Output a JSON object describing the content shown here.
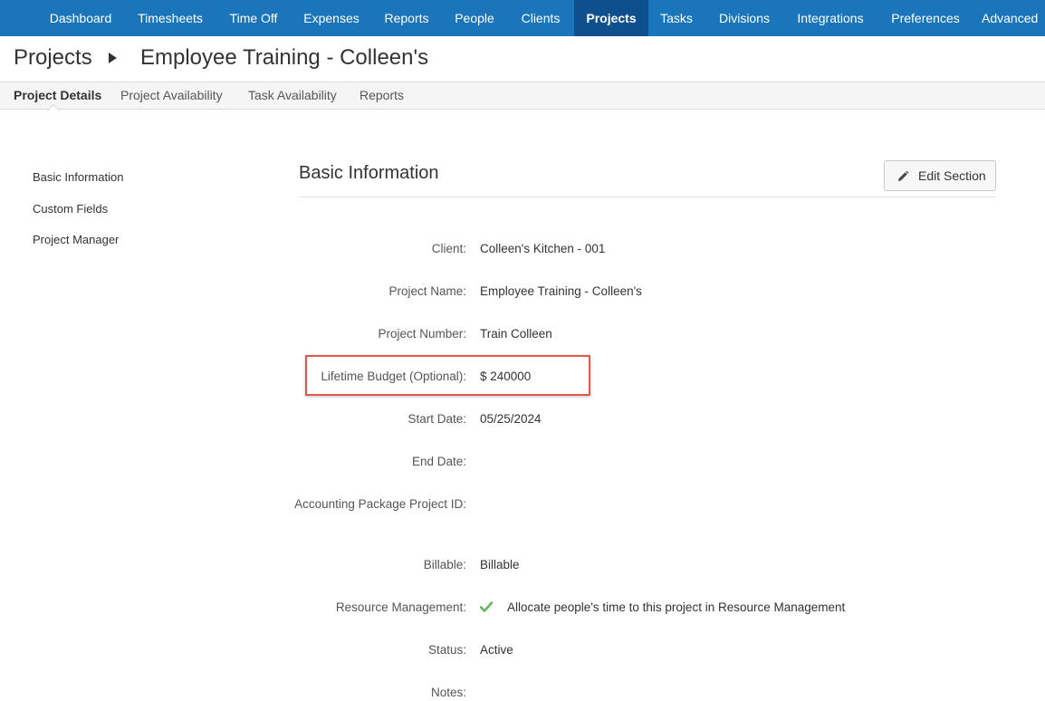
{
  "nav": {
    "items": [
      {
        "label": "Dashboard"
      },
      {
        "label": "Timesheets"
      },
      {
        "label": "Time Off"
      },
      {
        "label": "Expenses"
      },
      {
        "label": "Reports"
      },
      {
        "label": "People"
      },
      {
        "label": "Clients"
      },
      {
        "label": "Projects"
      },
      {
        "label": "Tasks"
      },
      {
        "label": "Divisions"
      },
      {
        "label": "Integrations"
      },
      {
        "label": "Preferences"
      },
      {
        "label": "Advanced"
      }
    ],
    "active": "Projects"
  },
  "breadcrumb": {
    "root": "Projects",
    "title": "Employee Training - Colleen's"
  },
  "subtabs": [
    {
      "label": "Project Details"
    },
    {
      "label": "Project Availability"
    },
    {
      "label": "Task Availability"
    },
    {
      "label": "Reports"
    }
  ],
  "sidebar": {
    "items": [
      {
        "label": "Basic Information"
      },
      {
        "label": "Custom Fields"
      },
      {
        "label": "Project Manager"
      }
    ]
  },
  "section": {
    "title": "Basic Information",
    "edit_label": "Edit Section"
  },
  "fields": {
    "client": {
      "label": "Client:",
      "value": "Colleen's Kitchen - 001"
    },
    "project_name": {
      "label": "Project Name:",
      "value": "Employee Training - Colleen's"
    },
    "project_number": {
      "label": "Project Number:",
      "value": "Train Colleen"
    },
    "lifetime_budget": {
      "label": "Lifetime Budget (Optional):",
      "value": "$ 240000"
    },
    "start_date": {
      "label": "Start Date:",
      "value": "05/25/2024"
    },
    "end_date": {
      "label": "End Date:",
      "value": ""
    },
    "accounting_id": {
      "label": "Accounting Package Project ID:",
      "value": ""
    },
    "billable": {
      "label": "Billable:",
      "value": "Billable"
    },
    "resource_management": {
      "label": "Resource Management:",
      "value": "Allocate people's time to this project in Resource Management"
    },
    "status": {
      "label": "Status:",
      "value": "Active"
    },
    "notes": {
      "label": "Notes:",
      "value": ""
    }
  },
  "colors": {
    "nav_bg": "#1b75bb",
    "nav_active": "#0e4f8e",
    "highlight": "#e4584b",
    "check": "#5cb85c"
  },
  "icons": {
    "edit": "pencil-icon",
    "breadcrumb_separator": "caret-right-icon",
    "resource_management": "check-icon"
  }
}
